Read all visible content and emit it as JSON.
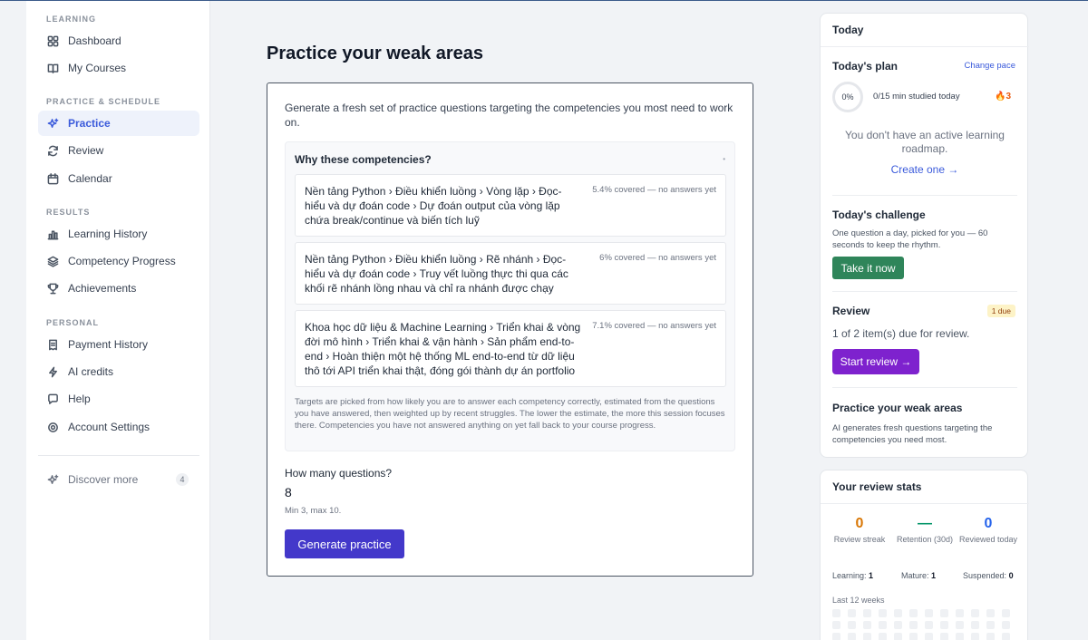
{
  "sidebar": {
    "sections": [
      {
        "title": "LEARNING"
      },
      {
        "title": "PRACTICE & SCHEDULE"
      },
      {
        "title": "RESULTS"
      },
      {
        "title": "PERSONAL"
      }
    ],
    "items": [
      {
        "label": "Dashboard",
        "icon": "grid-icon"
      },
      {
        "label": "My Courses",
        "icon": "book-icon"
      },
      {
        "label": "Practice",
        "icon": "sparkle-icon",
        "active": true
      },
      {
        "label": "Review",
        "icon": "refresh-icon"
      },
      {
        "label": "Calendar",
        "icon": "calendar-icon"
      },
      {
        "label": "Learning History",
        "icon": "bar-chart-icon"
      },
      {
        "label": "Competency Progress",
        "icon": "layers-icon"
      },
      {
        "label": "Achievements",
        "icon": "trophy-icon"
      },
      {
        "label": "Payment History",
        "icon": "receipt-icon"
      },
      {
        "label": "AI credits",
        "icon": "bolt-icon"
      },
      {
        "label": "Help",
        "icon": "chat-icon"
      },
      {
        "label": "Account Settings",
        "icon": "gear-icon"
      }
    ],
    "discover": {
      "label": "Discover more",
      "count": "4",
      "icon": "sparkle-icon"
    }
  },
  "main": {
    "title": "Practice your weak areas",
    "intro": "Generate a fresh set of practice questions targeting the competencies you most need to work on.",
    "why": {
      "title": "Why these competencies?",
      "competencies": [
        {
          "path": "Nền tảng Python › Điều khiển luồng › Vòng lặp › Đọc-hiểu và dự đoán code › Dự đoán output của vòng lặp chứa break/continue và biến tích luỹ",
          "coverage": "5.4% covered — no answers yet"
        },
        {
          "path": "Nền tảng Python › Điều khiển luồng › Rẽ nhánh › Đọc-hiểu và dự đoán code › Truy vết luồng thực thi qua các khối rẽ nhánh lồng nhau và chỉ ra nhánh được chạy",
          "coverage": "6% covered — no answers yet"
        },
        {
          "path": "Khoa học dữ liệu & Machine Learning › Triển khai & vòng đời mô hình › Triển khai & vận hành › Sản phẩm end-to-end › Hoàn thiện một hệ thống ML end-to-end từ dữ liệu thô tới API triển khai thật, đóng gói thành dự án portfolio",
          "coverage": "7.1% covered — no answers yet"
        }
      ],
      "note": "Targets are picked from how likely you are to answer each competency correctly, estimated from the questions you have answered, then weighted up by recent struggles. The lower the estimate, the more this session focuses there. Competencies you have not answered anything on yet fall back to your course progress."
    },
    "how_many_label": "How many questions?",
    "how_many_value": "8",
    "how_many_hint": "Min 3, max 10.",
    "generate_label": "Generate practice"
  },
  "right": {
    "today_title": "Today",
    "plan_title": "Today's plan",
    "change_pace": "Change pace",
    "progress_pct": "0%",
    "progress_value": 0,
    "studied": "0/15 min studied today",
    "streak": "🔥3",
    "no_roadmap": "You don't have an active learning roadmap.",
    "create_one": "Create one →",
    "challenge_title": "Today's challenge",
    "challenge_desc": "One question a day, picked for you — 60 seconds to keep the rhythm.",
    "take_it_now": "Take it now",
    "review_title": "Review",
    "due_badge": "1 due",
    "review_line": "1 of 2 item(s) due for review.",
    "start_review": "Start review →",
    "weak_title": "Practice your weak areas",
    "weak_desc": "AI generates fresh questions targeting the competencies you need most.",
    "stats_title": "Your review stats",
    "stats": [
      {
        "value": "0",
        "label": "Review streak",
        "color": "#d97706"
      },
      {
        "value": "—",
        "label": "Retention (30d)",
        "color": "#059669"
      },
      {
        "value": "0",
        "label": "Reviewed today",
        "color": "#2563eb"
      }
    ],
    "learning_label": "Learning:",
    "learning_value": "1",
    "mature_label": "Mature:",
    "mature_value": "1",
    "suspended_label": "Suspended:",
    "suspended_value": "0",
    "weeks_label": "Last 12 weeks"
  }
}
